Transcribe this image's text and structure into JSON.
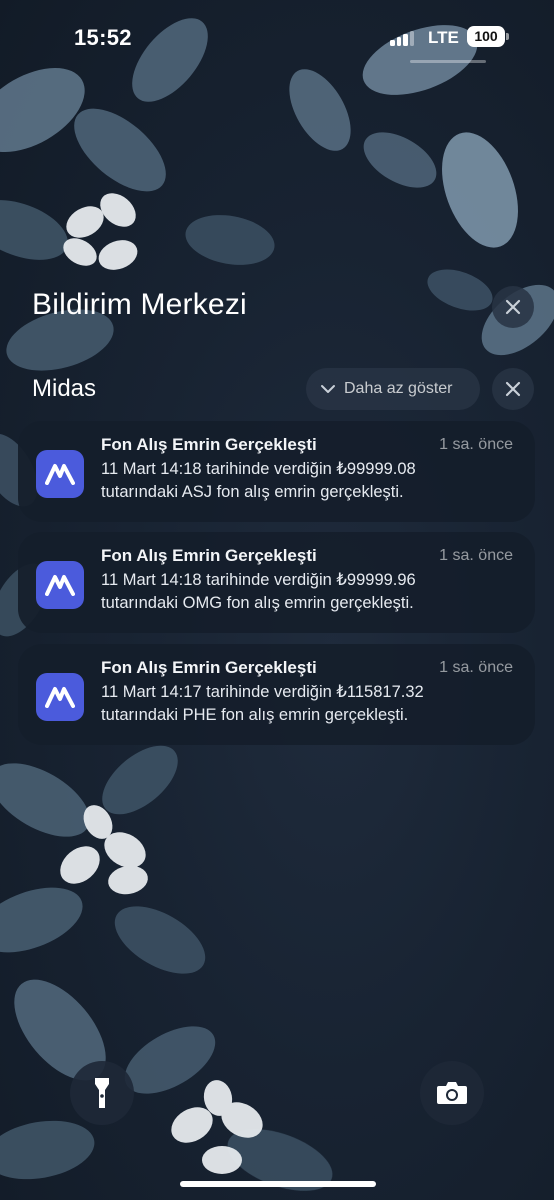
{
  "status_bar": {
    "time": "15:52",
    "network": "LTE",
    "battery": "100"
  },
  "notification_center": {
    "title": "Bildirim Merkezi"
  },
  "app_group": {
    "app_name": "Midas",
    "show_less_label": "Daha az göster"
  },
  "notifications": [
    {
      "title": "Fon Alış Emrin Gerçekleşti",
      "time": "1 sa. önce",
      "line1": "11 Mart 14:18 tarihinde verdiğin ₺99999.08",
      "line2": "tutarındaki ASJ fon alış emrin gerçekleşti."
    },
    {
      "title": "Fon Alış Emrin Gerçekleşti",
      "time": "1 sa. önce",
      "line1": "11 Mart 14:18 tarihinde verdiğin ₺99999.96",
      "line2": "tutarındaki OMG fon alış emrin gerçekleşti."
    },
    {
      "title": "Fon Alış Emrin Gerçekleşti",
      "time": "1 sa. önce",
      "line1": "11 Mart 14:17 tarihinde verdiğin ₺115817.32",
      "line2": "tutarındaki PHE fon alış emrin gerçekleşti."
    }
  ],
  "icons": {
    "app": "midas-logo-icon",
    "flashlight": "flashlight-icon",
    "camera": "camera-icon",
    "close": "close-icon",
    "chevron": "chevron-down-icon"
  },
  "colors": {
    "app_icon": "#4b5bdc",
    "card": "#141e2b"
  }
}
